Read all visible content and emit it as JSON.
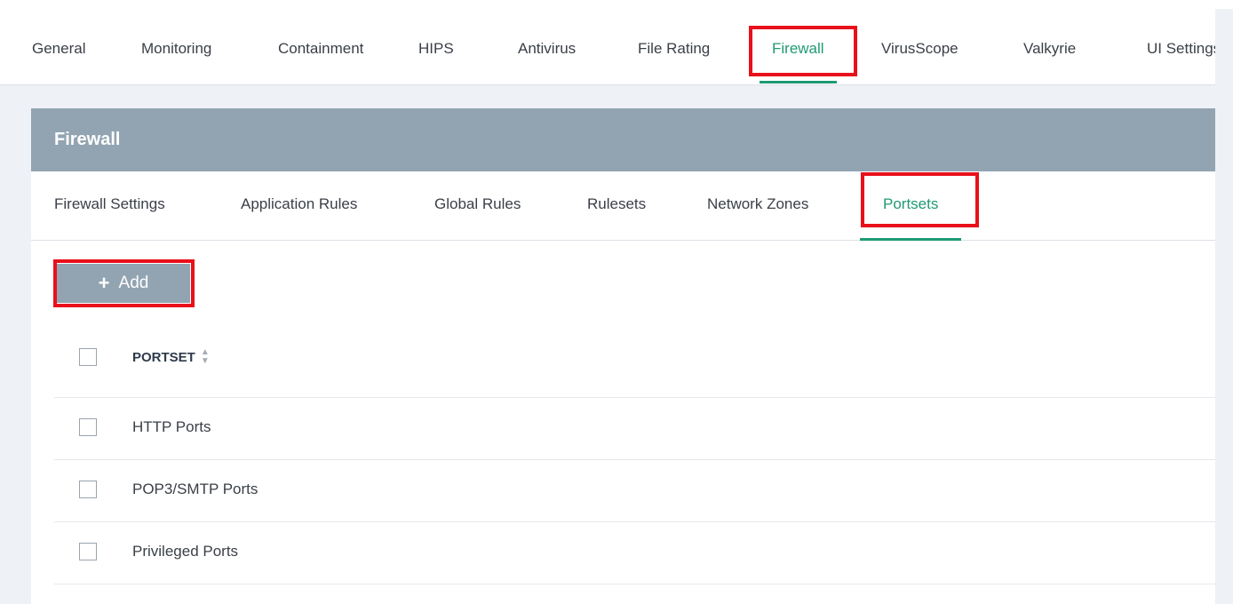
{
  "top_tabs": [
    {
      "label": "General"
    },
    {
      "label": "Monitoring"
    },
    {
      "label": "Containment"
    },
    {
      "label": "HIPS"
    },
    {
      "label": "Antivirus"
    },
    {
      "label": "File Rating"
    },
    {
      "label": "Firewall"
    },
    {
      "label": "VirusScope"
    },
    {
      "label": "Valkyrie"
    },
    {
      "label": "UI Settings"
    }
  ],
  "active_top_tab": "Firewall",
  "panel": {
    "title": "Firewall",
    "sub_tabs": [
      {
        "label": "Firewall Settings"
      },
      {
        "label": "Application Rules"
      },
      {
        "label": "Global Rules"
      },
      {
        "label": "Rulesets"
      },
      {
        "label": "Network Zones"
      },
      {
        "label": "Portsets"
      }
    ],
    "active_sub_tab": "Portsets"
  },
  "toolbar": {
    "add_label": "Add",
    "add_icon": "plus-icon"
  },
  "table": {
    "column_header": "PORTSET",
    "sort_icon": "sort-icon",
    "rows": [
      {
        "name": "HTTP Ports"
      },
      {
        "name": "POP3/SMTP Ports"
      },
      {
        "name": "Privileged Ports"
      }
    ]
  },
  "colors": {
    "accent": "#1f9a74",
    "header_bg": "#92a4b2",
    "highlight": "#e8101a"
  }
}
